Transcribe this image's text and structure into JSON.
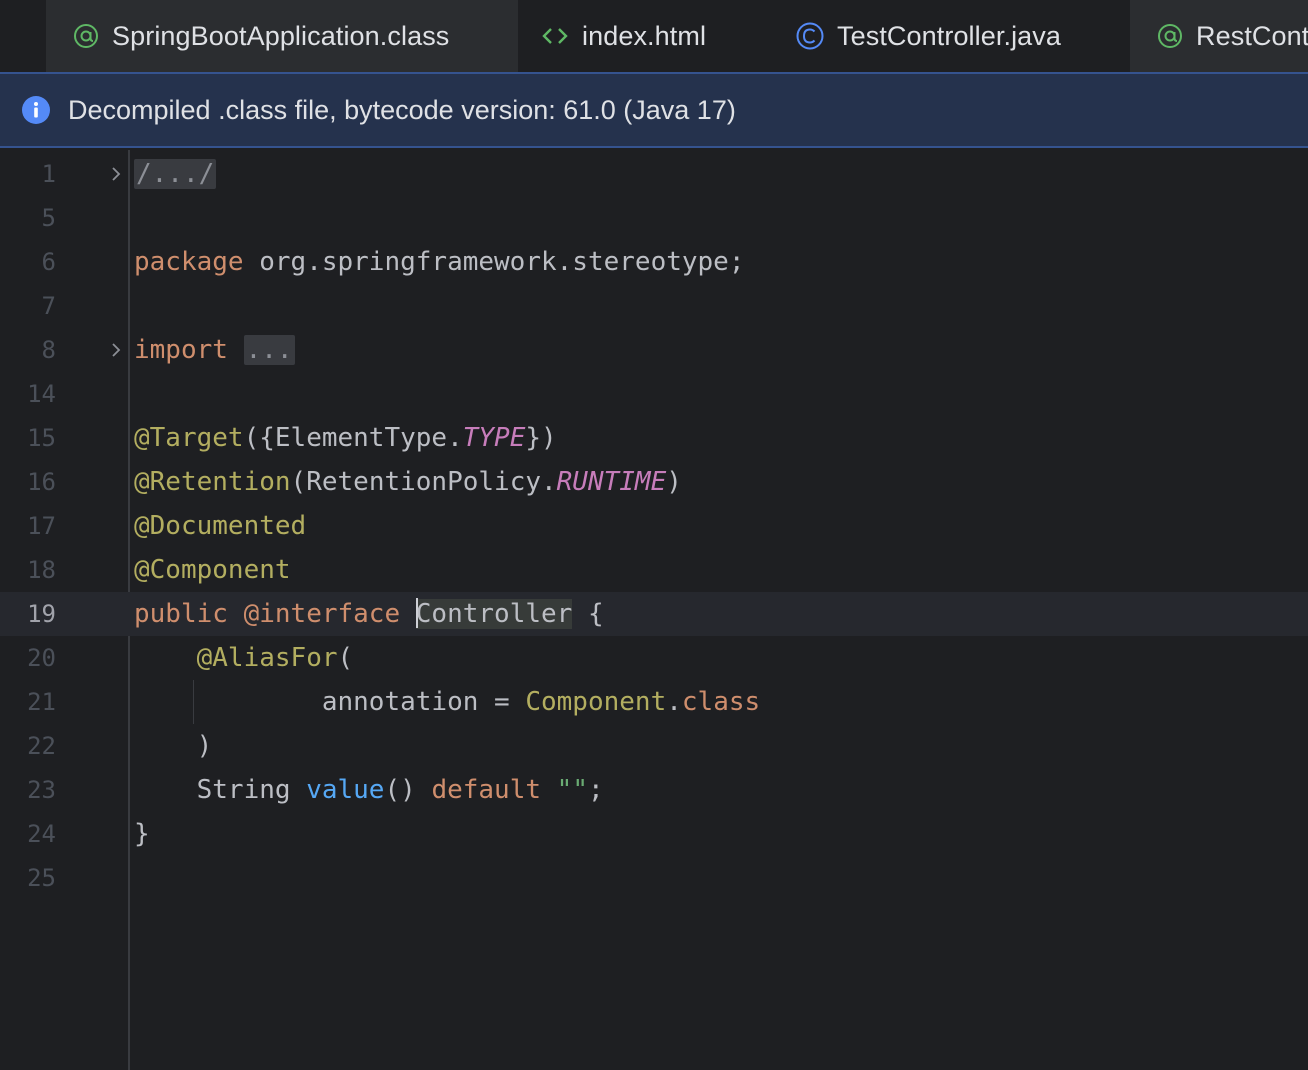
{
  "tabs": [
    {
      "label": "SpringBootApplication.class",
      "icon": "annotation-icon",
      "active": true
    },
    {
      "label": "index.html",
      "icon": "html-icon",
      "active": false
    },
    {
      "label": "TestController.java",
      "icon": "class-icon",
      "active": false
    },
    {
      "label": "RestCont",
      "icon": "annotation-icon",
      "active": false
    }
  ],
  "banner": {
    "icon": "info-icon",
    "text": "Decompiled .class file, bytecode version: 61.0 (Java 17)"
  },
  "editor": {
    "line_numbers": [
      "1",
      "5",
      "6",
      "7",
      "8",
      "14",
      "15",
      "16",
      "17",
      "18",
      "19",
      "20",
      "21",
      "22",
      "23",
      "24",
      "25"
    ],
    "caret_line": "19",
    "lines": [
      [
        {
          "t": "/.../",
          "c": "folded"
        }
      ],
      [],
      [
        {
          "t": "package",
          "c": "kw"
        },
        {
          "t": " org.springframework.stereotype;",
          "c": "plain"
        }
      ],
      [],
      [
        {
          "t": "import",
          "c": "kw"
        },
        {
          "t": " ",
          "c": "plain"
        },
        {
          "t": "...",
          "c": "folded"
        }
      ],
      [],
      [
        {
          "t": "@Target",
          "c": "ann"
        },
        {
          "t": "({ElementType.",
          "c": "plain"
        },
        {
          "t": "TYPE",
          "c": "const"
        },
        {
          "t": "})",
          "c": "plain"
        }
      ],
      [
        {
          "t": "@Retention",
          "c": "ann"
        },
        {
          "t": "(RetentionPolicy.",
          "c": "plain"
        },
        {
          "t": "RUNTIME",
          "c": "const"
        },
        {
          "t": ")",
          "c": "plain"
        }
      ],
      [
        {
          "t": "@Documented",
          "c": "ann"
        }
      ],
      [
        {
          "t": "@Component",
          "c": "ann"
        }
      ],
      [
        {
          "t": "public",
          "c": "kw"
        },
        {
          "t": " ",
          "c": "plain"
        },
        {
          "t": "@interface",
          "c": "kw"
        },
        {
          "t": " ",
          "c": "plain"
        },
        {
          "t": "Controller",
          "c": "plain ident-hl",
          "caret": true
        },
        {
          "t": " {",
          "c": "plain"
        }
      ],
      [
        {
          "t": "    ",
          "c": "plain"
        },
        {
          "t": "@AliasFor",
          "c": "ann"
        },
        {
          "t": "(",
          "c": "plain"
        }
      ],
      [
        {
          "t": "            annotation = ",
          "c": "plain"
        },
        {
          "t": "Component",
          "c": "ann"
        },
        {
          "t": ".",
          "c": "plain"
        },
        {
          "t": "class",
          "c": "kw"
        }
      ],
      [
        {
          "t": "    )",
          "c": "plain"
        }
      ],
      [
        {
          "t": "    String ",
          "c": "plain"
        },
        {
          "t": "value",
          "c": "fn"
        },
        {
          "t": "() ",
          "c": "plain"
        },
        {
          "t": "default",
          "c": "kw"
        },
        {
          "t": " ",
          "c": "plain"
        },
        {
          "t": "\"\"",
          "c": "str"
        },
        {
          "t": ";",
          "c": "plain"
        }
      ],
      [
        {
          "t": "}",
          "c": "plain"
        }
      ],
      []
    ],
    "fold_markers": [
      "1",
      "8"
    ]
  },
  "colors": {
    "background": "#1e1f22",
    "active_tab": "#2b2d30",
    "banner_bg": "#25324d",
    "banner_border": "#35538f",
    "keyword": "#cf8e6d",
    "annotation": "#b3ae60",
    "constant": "#c77dbb",
    "function": "#56a8f5",
    "string": "#6aab73",
    "text": "#bcbec4"
  }
}
